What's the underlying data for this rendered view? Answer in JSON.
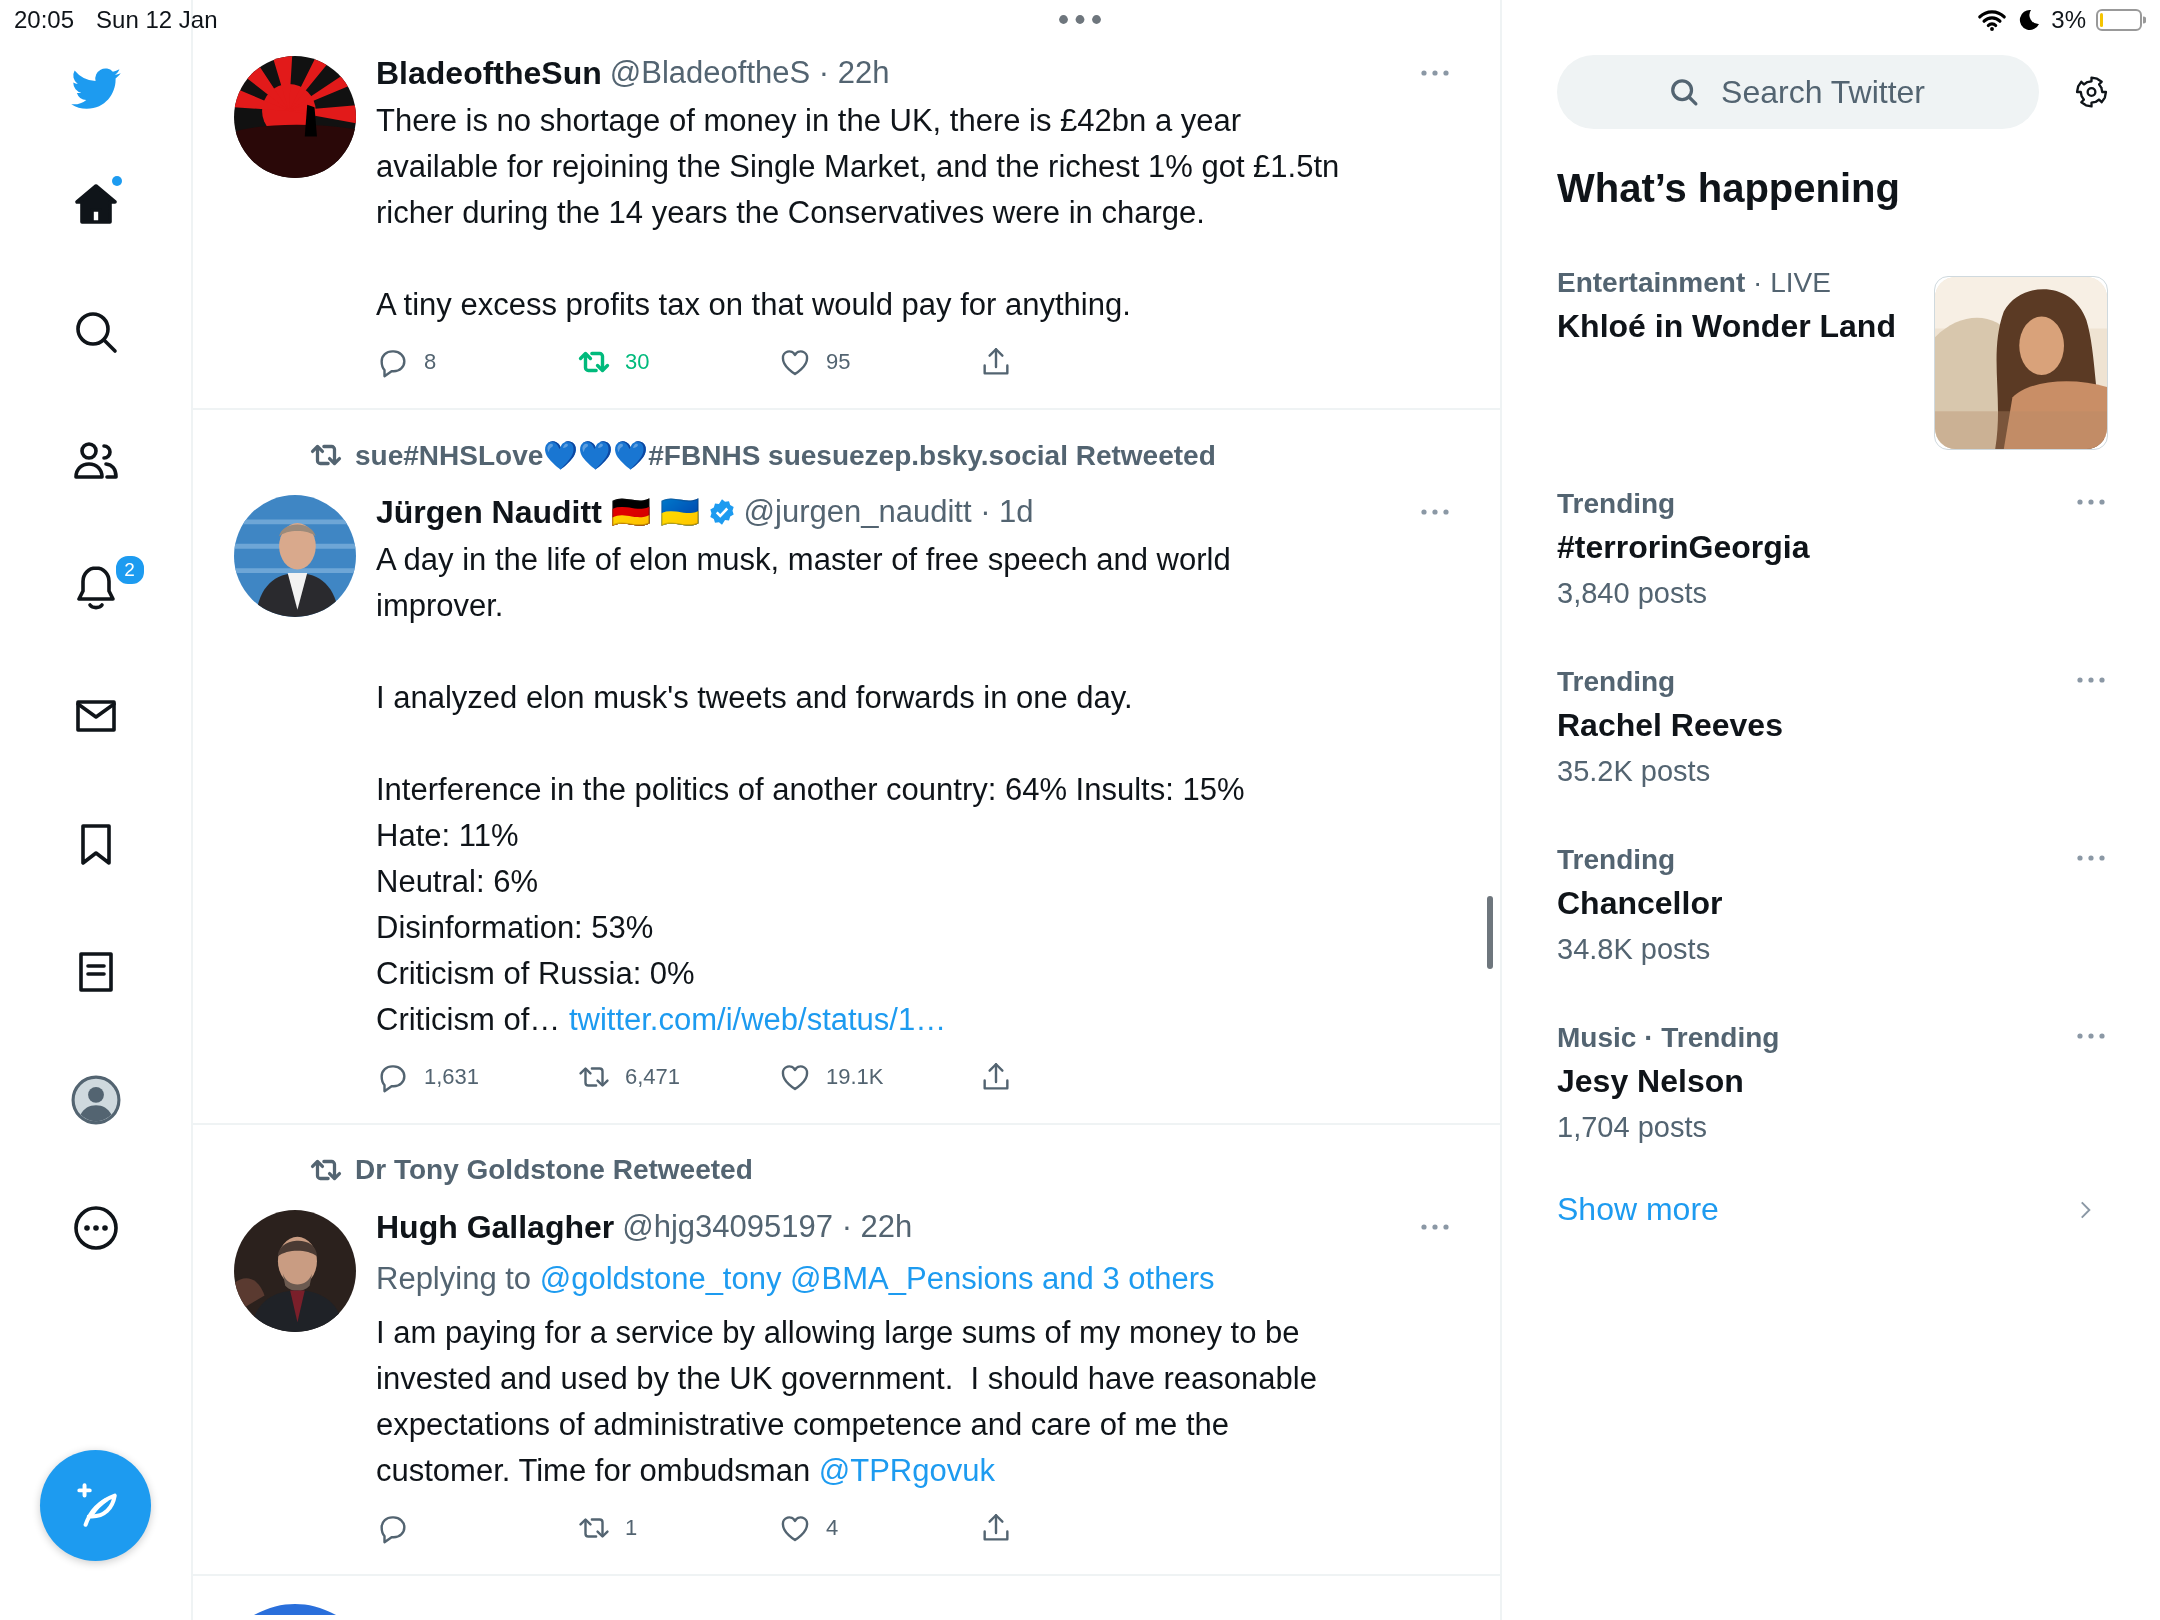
{
  "status_bar": {
    "time": "20:05",
    "date": "Sun 12 Jan",
    "battery": "3%"
  },
  "sidebar": {
    "items": [
      {
        "kind": "logo"
      },
      {
        "kind": "home",
        "unread": true
      },
      {
        "kind": "search"
      },
      {
        "kind": "communities"
      },
      {
        "kind": "notifications",
        "badge": "2"
      },
      {
        "kind": "messages"
      },
      {
        "kind": "bookmarks"
      },
      {
        "kind": "lists"
      },
      {
        "kind": "profile"
      },
      {
        "kind": "more"
      }
    ]
  },
  "tweets": [
    {
      "kind": "tweet",
      "name": "BladeoftheSun",
      "meta": "@BladeoftheS · 22h",
      "body": [
        [
          {
            "kind": "text",
            "text": "There is no shortage of money in the UK, there is £42bn a year\navailable for rejoining the Single Market, and the richest 1% got £1.5tn\nricher during the 14 years the Conservatives were in charge."
          }
        ],
        [
          {
            "kind": "text",
            "text": "A tiny excess profits tax on that would pay for anything."
          }
        ]
      ],
      "actions": [
        {
          "kind": "reply",
          "count": "8",
          "active": false
        },
        {
          "kind": "retweet",
          "count": "30",
          "active": true
        },
        {
          "kind": "like",
          "count": "95",
          "active": false
        },
        {
          "kind": "share",
          "active": false
        }
      ]
    },
    {
      "kind": "tweet",
      "retweeted_by": "sue#NHSLove💙💙💙#FBNHS suesuezep.bsky.social Retweeted",
      "name": "Jürgen Nauditt 🇩🇪 🇺🇦",
      "verified": true,
      "meta": "@jurgen_nauditt · 1d",
      "body": [
        [
          {
            "kind": "text",
            "text": "A day in the life of elon musk, master of free speech and world\nimprover."
          }
        ],
        [
          {
            "kind": "text",
            "text": "I analyzed elon musk's tweets and forwards in one day."
          }
        ],
        [
          {
            "kind": "text",
            "text": "Interference in the politics of another country: 64% Insults: 15%\nHate: 11%\nNeutral: 6%\nDisinformation: 53%\nCriticism of Russia: 0%\nCriticism of… "
          },
          {
            "kind": "link",
            "text": "twitter.com/i/web/status/1…"
          }
        ]
      ],
      "actions": [
        {
          "kind": "reply",
          "count": "1,631",
          "active": false
        },
        {
          "kind": "retweet",
          "count": "6,471",
          "active": false
        },
        {
          "kind": "like",
          "count": "19.1K",
          "active": false
        },
        {
          "kind": "share",
          "active": false
        }
      ]
    },
    {
      "kind": "tweet",
      "retweeted_by": "Dr Tony Goldstone Retweeted",
      "name": "Hugh Gallagher",
      "meta": "@hjg34095197 · 22h",
      "replying_to": {
        "label": "Replying to",
        "targets": "@goldstone_tony @BMA_Pensions and 3 others"
      },
      "body": [
        [
          {
            "kind": "text",
            "text": "I am paying for a service by allowing large sums of my money to be\ninvested and used by the UK government.  I should have reasonable\nexpectations of administrative competence and care of me the\ncustomer. Time for ombudsman "
          },
          {
            "kind": "link",
            "text": "@TPRgovuk"
          }
        ]
      ],
      "actions": [
        {
          "kind": "reply",
          "active": false
        },
        {
          "kind": "retweet",
          "count": "1",
          "active": false
        },
        {
          "kind": "like",
          "count": "4",
          "active": false
        },
        {
          "kind": "share",
          "active": false
        }
      ]
    },
    {
      "kind": "cut"
    }
  ],
  "right_panel": {
    "search": {
      "placeholder": "Search Twitter"
    },
    "heading": "What’s happening",
    "trends": [
      {
        "kind": "media",
        "category": "**Entertainment** · LIVE",
        "title": "Khloé in Wonder Land"
      },
      {
        "kind": "trend",
        "category": "Trending",
        "title": "#terrorinGeorgia",
        "posts": "3,840 posts"
      },
      {
        "kind": "trend",
        "category": "Trending",
        "title": "Rachel Reeves",
        "posts": "35.2K posts"
      },
      {
        "kind": "trend",
        "category": "Trending",
        "title": "Chancellor",
        "posts": "34.8K posts"
      },
      {
        "kind": "trend",
        "category": "Music · Trending",
        "title": "Jesy Nelson",
        "posts": "1,704 posts"
      }
    ],
    "show_more": "Show more"
  }
}
